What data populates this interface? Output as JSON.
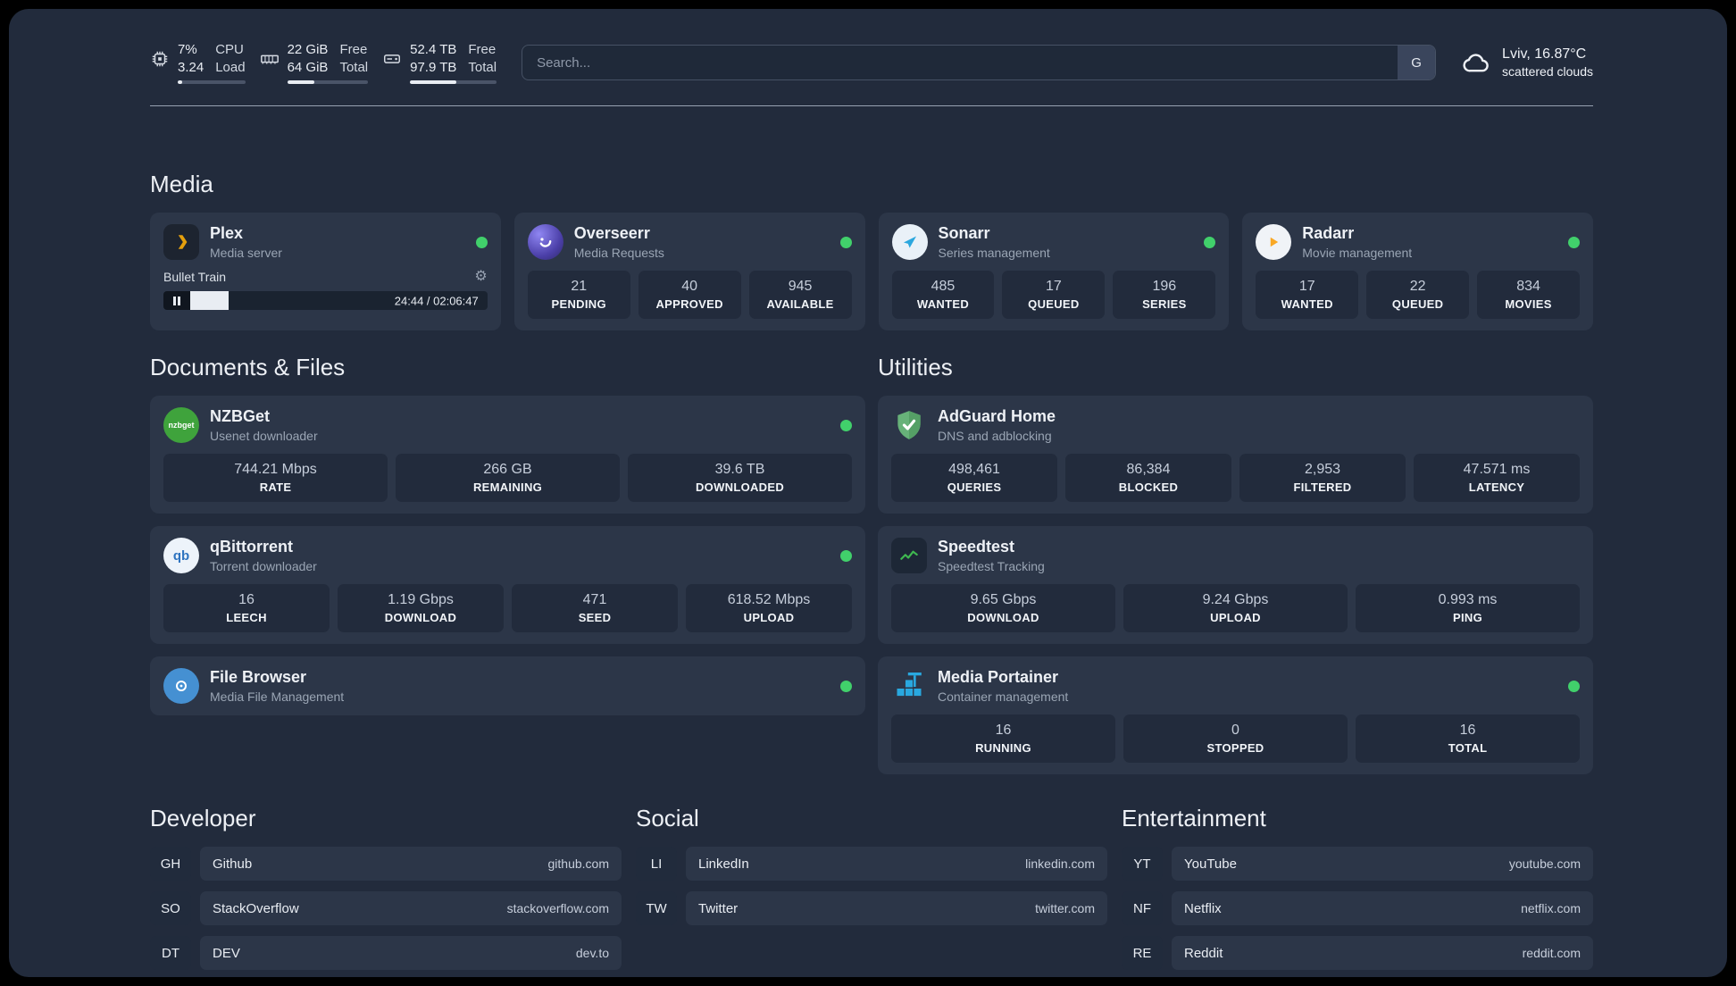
{
  "topbar": {
    "cpu": {
      "values": [
        "7%",
        "3.24"
      ],
      "labels": [
        "CPU",
        "Load"
      ],
      "progress": 7
    },
    "memory": {
      "values": [
        "22 GiB",
        "64 GiB"
      ],
      "labels": [
        "Free",
        "Total"
      ],
      "progress": 34
    },
    "storage": {
      "values": [
        "52.4 TB",
        "97.9 TB"
      ],
      "labels": [
        "Free",
        "Total"
      ],
      "progress": 54
    },
    "search": {
      "placeholder": "Search...",
      "button_label": "G"
    },
    "weather": {
      "location": "Lviv, 16.87°C",
      "condition": "scattered clouds"
    }
  },
  "sections": {
    "media": {
      "title": "Media"
    },
    "documents": {
      "title": "Documents & Files"
    },
    "utilities": {
      "title": "Utilities"
    },
    "developer": {
      "title": "Developer"
    },
    "social": {
      "title": "Social"
    },
    "entertainment": {
      "title": "Entertainment"
    }
  },
  "services": {
    "plex": {
      "name": "Plex",
      "subtitle": "Media server",
      "player": {
        "title": "Bullet Train",
        "time": "24:44 / 02:06:47",
        "progress": 13
      }
    },
    "overseerr": {
      "name": "Overseerr",
      "subtitle": "Media Requests",
      "stats": [
        {
          "value": "21",
          "label": "PENDING"
        },
        {
          "value": "40",
          "label": "APPROVED"
        },
        {
          "value": "945",
          "label": "AVAILABLE"
        }
      ]
    },
    "sonarr": {
      "name": "Sonarr",
      "subtitle": "Series management",
      "stats": [
        {
          "value": "485",
          "label": "WANTED"
        },
        {
          "value": "17",
          "label": "QUEUED"
        },
        {
          "value": "196",
          "label": "SERIES"
        }
      ]
    },
    "radarr": {
      "name": "Radarr",
      "subtitle": "Movie management",
      "stats": [
        {
          "value": "17",
          "label": "WANTED"
        },
        {
          "value": "22",
          "label": "QUEUED"
        },
        {
          "value": "834",
          "label": "MOVIES"
        }
      ]
    },
    "nzbget": {
      "name": "NZBGet",
      "subtitle": "Usenet downloader",
      "stats": [
        {
          "value": "744.21 Mbps",
          "label": "RATE"
        },
        {
          "value": "266 GB",
          "label": "REMAINING"
        },
        {
          "value": "39.6 TB",
          "label": "DOWNLOADED"
        }
      ]
    },
    "qbittorrent": {
      "name": "qBittorrent",
      "subtitle": "Torrent downloader",
      "stats": [
        {
          "value": "16",
          "label": "LEECH"
        },
        {
          "value": "1.19 Gbps",
          "label": "DOWNLOAD"
        },
        {
          "value": "471",
          "label": "SEED"
        },
        {
          "value": "618.52 Mbps",
          "label": "UPLOAD"
        }
      ]
    },
    "filebrowser": {
      "name": "File Browser",
      "subtitle": "Media File Management"
    },
    "adguard": {
      "name": "AdGuard Home",
      "subtitle": "DNS and adblocking",
      "stats": [
        {
          "value": "498,461",
          "label": "QUERIES"
        },
        {
          "value": "86,384",
          "label": "BLOCKED"
        },
        {
          "value": "2,953",
          "label": "FILTERED"
        },
        {
          "value": "47.571 ms",
          "label": "LATENCY"
        }
      ]
    },
    "speedtest": {
      "name": "Speedtest",
      "subtitle": "Speedtest Tracking",
      "stats": [
        {
          "value": "9.65 Gbps",
          "label": "DOWNLOAD"
        },
        {
          "value": "9.24 Gbps",
          "label": "UPLOAD"
        },
        {
          "value": "0.993 ms",
          "label": "PING"
        }
      ]
    },
    "portainer": {
      "name": "Media Portainer",
      "subtitle": "Container management",
      "stats": [
        {
          "value": "16",
          "label": "RUNNING"
        },
        {
          "value": "0",
          "label": "STOPPED"
        },
        {
          "value": "16",
          "label": "TOTAL"
        }
      ]
    }
  },
  "bookmarks": {
    "developer": [
      {
        "abbr": "GH",
        "name": "Github",
        "domain": "github.com"
      },
      {
        "abbr": "SO",
        "name": "StackOverflow",
        "domain": "stackoverflow.com"
      },
      {
        "abbr": "DT",
        "name": "DEV",
        "domain": "dev.to"
      }
    ],
    "social": [
      {
        "abbr": "LI",
        "name": "LinkedIn",
        "domain": "linkedin.com"
      },
      {
        "abbr": "TW",
        "name": "Twitter",
        "domain": "twitter.com"
      }
    ],
    "entertainment": [
      {
        "abbr": "YT",
        "name": "YouTube",
        "domain": "youtube.com"
      },
      {
        "abbr": "NF",
        "name": "Netflix",
        "domain": "netflix.com"
      },
      {
        "abbr": "RE",
        "name": "Reddit",
        "domain": "reddit.com"
      }
    ]
  },
  "icons": {
    "gear": "⚙",
    "nzbget_text": "nzbget",
    "qb_text": "qb"
  },
  "colors": {
    "status_online": "#41d06b",
    "plex_amber": "#e5a00d",
    "background": "#222b3c",
    "card": "#2c3648"
  }
}
